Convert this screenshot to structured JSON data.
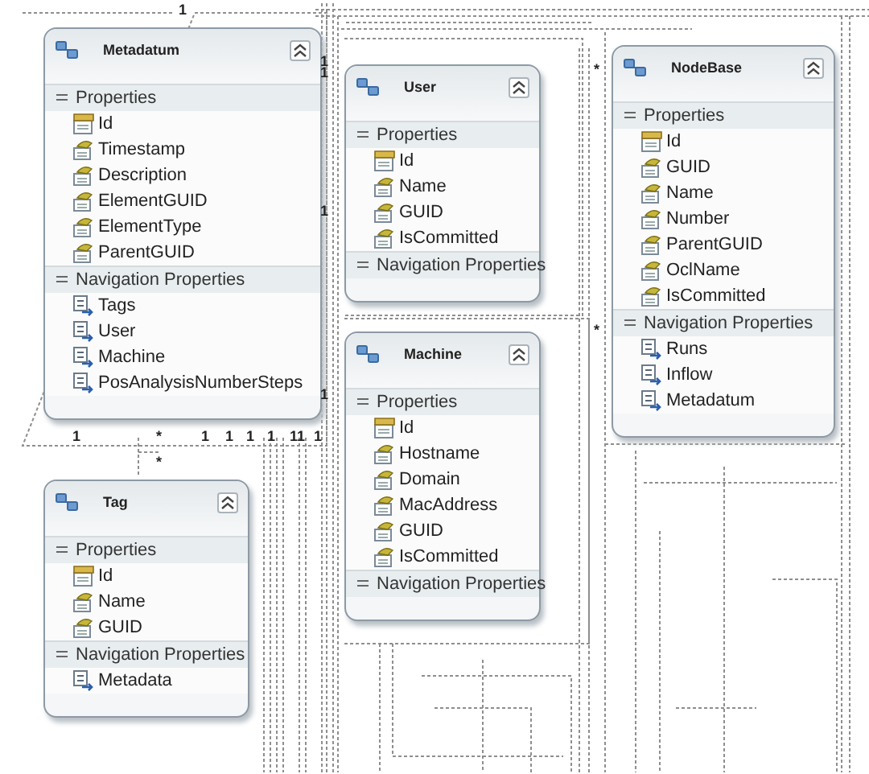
{
  "entities": [
    {
      "name": "Metadatum",
      "expanded": true,
      "sections": [
        {
          "title": "Properties",
          "expanded": true,
          "items": [
            {
              "name": "Id",
              "kind": "key"
            },
            {
              "name": "Timestamp",
              "kind": "scalar"
            },
            {
              "name": "Description",
              "kind": "scalar"
            },
            {
              "name": "ElementGUID",
              "kind": "scalar"
            },
            {
              "name": "ElementType",
              "kind": "scalar"
            },
            {
              "name": "ParentGUID",
              "kind": "scalar"
            }
          ]
        },
        {
          "title": "Navigation Properties",
          "expanded": true,
          "items": [
            {
              "name": "Tags",
              "kind": "navigation"
            },
            {
              "name": "User",
              "kind": "navigation"
            },
            {
              "name": "Machine",
              "kind": "navigation"
            },
            {
              "name": "PosAnalysisNumberSteps",
              "kind": "navigation"
            }
          ]
        }
      ]
    },
    {
      "name": "User",
      "expanded": true,
      "sections": [
        {
          "title": "Properties",
          "expanded": true,
          "items": [
            {
              "name": "Id",
              "kind": "key"
            },
            {
              "name": "Name",
              "kind": "scalar"
            },
            {
              "name": "GUID",
              "kind": "scalar"
            },
            {
              "name": "IsCommitted",
              "kind": "scalar"
            }
          ]
        },
        {
          "title": "Navigation Properties",
          "expanded": true
        }
      ]
    },
    {
      "name": "Machine",
      "expanded": true,
      "sections": [
        {
          "title": "Properties",
          "expanded": true,
          "items": [
            {
              "name": "Id",
              "kind": "key"
            },
            {
              "name": "Hostname",
              "kind": "scalar"
            },
            {
              "name": "Domain",
              "kind": "scalar"
            },
            {
              "name": "MacAddress",
              "kind": "scalar"
            },
            {
              "name": "GUID",
              "kind": "scalar"
            },
            {
              "name": "IsCommitted",
              "kind": "scalar"
            }
          ]
        },
        {
          "title": "Navigation Properties",
          "expanded": true
        }
      ]
    },
    {
      "name": "NodeBase",
      "expanded": true,
      "sections": [
        {
          "title": "Properties",
          "expanded": true,
          "items": [
            {
              "name": "Id",
              "kind": "key"
            },
            {
              "name": "GUID",
              "kind": "scalar"
            },
            {
              "name": "Name",
              "kind": "scalar"
            },
            {
              "name": "Number",
              "kind": "scalar"
            },
            {
              "name": "ParentGUID",
              "kind": "scalar"
            },
            {
              "name": "OclName",
              "kind": "scalar"
            },
            {
              "name": "IsCommitted",
              "kind": "scalar"
            }
          ]
        },
        {
          "title": "Navigation Properties",
          "expanded": true,
          "items": [
            {
              "name": "Runs",
              "kind": "navigation"
            },
            {
              "name": "Inflow",
              "kind": "navigation"
            },
            {
              "name": "Metadatum",
              "kind": "navigation"
            }
          ]
        }
      ]
    },
    {
      "name": "Tag",
      "expanded": true,
      "sections": [
        {
          "title": "Properties",
          "expanded": true,
          "items": [
            {
              "name": "Id",
              "kind": "key"
            },
            {
              "name": "Name",
              "kind": "scalar"
            },
            {
              "name": "GUID",
              "kind": "scalar"
            }
          ]
        },
        {
          "title": "Navigation Properties",
          "expanded": true,
          "items": [
            {
              "name": "Metadata",
              "kind": "navigation"
            }
          ]
        }
      ]
    }
  ],
  "multiplicities": [
    "1",
    "1",
    "1",
    "1",
    "*",
    "1",
    "1",
    "1",
    "1",
    "11",
    "1",
    "*",
    "1",
    "1",
    "*",
    "*"
  ]
}
